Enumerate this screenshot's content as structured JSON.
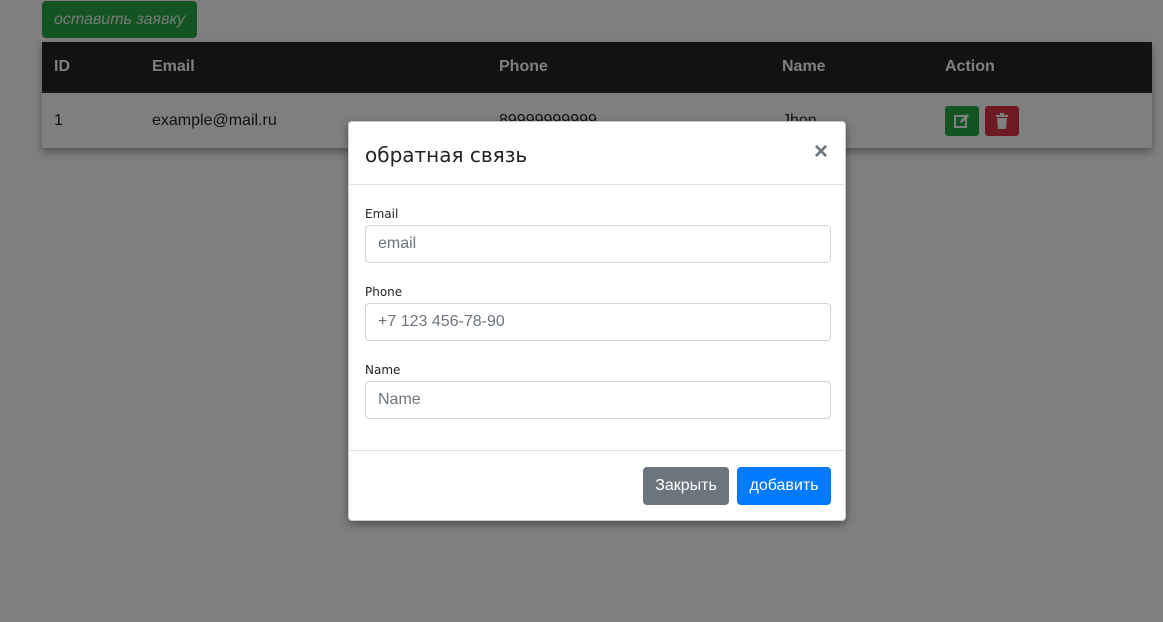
{
  "page": {
    "request_button_label": "оставить заявку"
  },
  "table": {
    "headers": [
      "ID",
      "Email",
      "Phone",
      "Name",
      "Action"
    ],
    "rows": [
      {
        "id": "1",
        "email": "example@mail.ru",
        "phone": "89999999999",
        "name": "Jhon"
      }
    ]
  },
  "modal": {
    "title": "обратная связь",
    "close_glyph": "×",
    "fields": [
      {
        "label": "Email",
        "placeholder": "email"
      },
      {
        "label": "Phone",
        "placeholder": "+7 123 456-78-90"
      },
      {
        "label": "Name",
        "placeholder": "Name"
      }
    ],
    "footer": {
      "close_label": "Закрыть",
      "add_label": "добавить"
    }
  },
  "colors": {
    "success": "#28a745",
    "danger": "#dc3545",
    "primary": "#007bff",
    "secondary": "#6c757d",
    "table_header": "#212529"
  },
  "icons": {
    "edit": "edit-icon",
    "delete": "trash-icon"
  }
}
